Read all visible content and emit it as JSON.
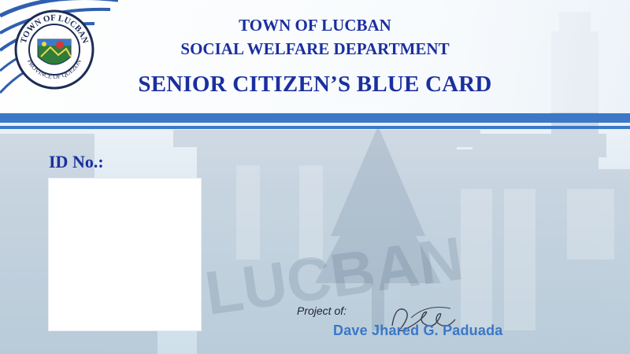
{
  "header": {
    "line1": "TOWN OF LUCBAN",
    "line2": "SOCIAL WELFARE DEPARTMENT",
    "card_title": "SENIOR CITIZEN’S BLUE CARD"
  },
  "seal": {
    "top_text": "TOWN OF LUCBAN",
    "bottom_text": "PROVINCE OF QUEZON"
  },
  "form": {
    "id_label": "ID No.:"
  },
  "footer": {
    "project_of": "Project of:",
    "author": "Dave Jhared G. Paduada"
  },
  "colors": {
    "title_blue": "#1a2fa0",
    "stripe_blue": "#3c78c8",
    "author_blue": "#3a78c6"
  }
}
